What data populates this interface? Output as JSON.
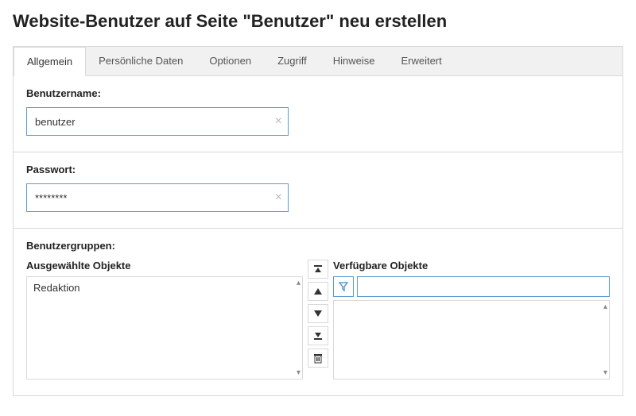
{
  "title": "Website-Benutzer auf Seite \"Benutzer\" neu erstellen",
  "tabs": {
    "general": "Allgemein",
    "personal": "Persönliche Daten",
    "options": "Optionen",
    "access": "Zugriff",
    "hints": "Hinweise",
    "advanced": "Erweitert"
  },
  "username": {
    "label": "Benutzername:",
    "value": "benutzer"
  },
  "password": {
    "label": "Passwort:",
    "value": "********"
  },
  "groups": {
    "label": "Benutzergruppen:",
    "selected_label": "Ausgewählte Objekte",
    "available_label": "Verfügbare Objekte",
    "selected_items": [
      "Redaktion"
    ],
    "filter_value": ""
  }
}
